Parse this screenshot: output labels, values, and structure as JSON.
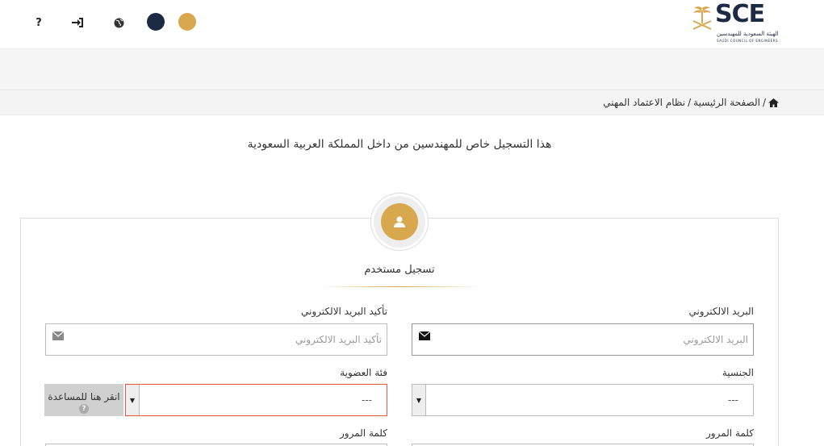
{
  "header": {
    "help_icon_glyph": "?",
    "logo_text": "SCE",
    "logo_subtitle_ar": "الهيئة السعودية للمهندسين",
    "logo_subtitle_en": "SAUDI COUNCIL OF ENGINEERS",
    "colors": {
      "dark_theme": "#1c2a44",
      "gold_theme": "#d8a84f"
    }
  },
  "breadcrumb": {
    "home": "الصفحة الرئيسية",
    "separator": "/",
    "current": "نظام الاعتماد المهني"
  },
  "notice": "هذا التسجيل خاص للمهندسين من داخل المملكة العربية السعودية",
  "card": {
    "title": "تسجيل مستخدم"
  },
  "form": {
    "email_label": "البريد الالكتروني",
    "email_placeholder": "البريد الالكتروني",
    "confirm_email_label": "تأكيد البريد الالكتروني",
    "confirm_email_placeholder": "تأكيد البريد الالكتروني",
    "nationality_label": "الجنسية",
    "nationality_value": "---",
    "membership_label": "فئة العضوية",
    "membership_value": "---",
    "help_text": "انقر هنا للمساعدة",
    "help_badge": "?",
    "password_label": "كلمة المرور",
    "password_confirm_label": "كلمة المرور"
  }
}
